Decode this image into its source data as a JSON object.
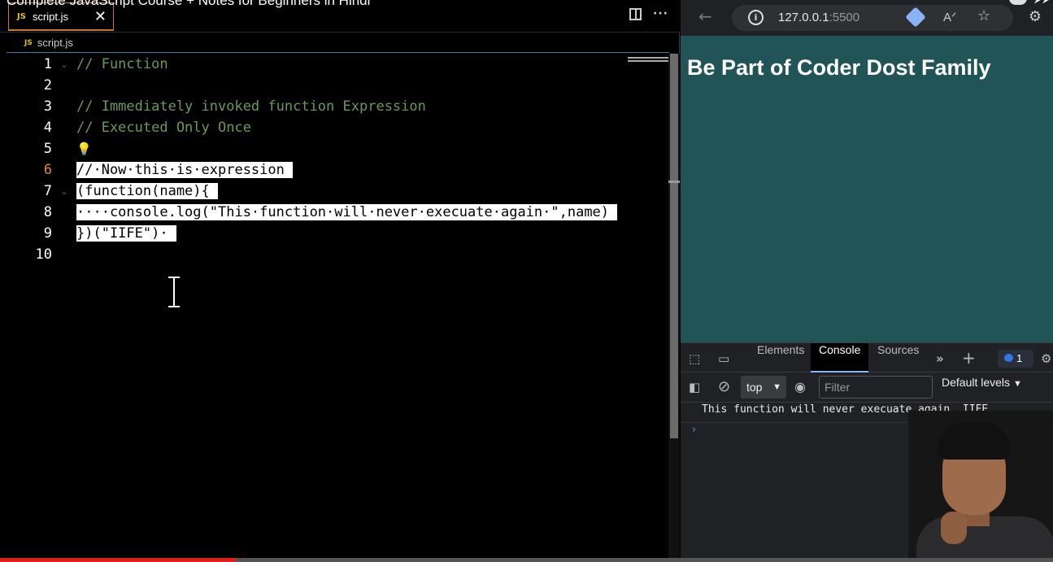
{
  "video": {
    "title": "Complete JavaScript Course + Notes for Beginners in Hindi",
    "progress_fraction": 0.224
  },
  "editor": {
    "tab_label": "script.js",
    "tab_badge": "JS",
    "tab_close": "✕",
    "breadcrumb_badge": "JS",
    "breadcrumb_file": "script.js",
    "lines": [
      {
        "n": "1",
        "text": "// Function",
        "fold": "⌄",
        "selected": false
      },
      {
        "n": "2",
        "text": "",
        "fold": "",
        "selected": false
      },
      {
        "n": "3",
        "text": "// Immediately invoked function Expression",
        "fold": "",
        "selected": false
      },
      {
        "n": "4",
        "text": "// Executed Only Once",
        "fold": "",
        "selected": false
      },
      {
        "n": "5",
        "text": "",
        "fold": "",
        "selected": false,
        "bulb": true
      },
      {
        "n": "6",
        "text": "//·Now·this·is·expression",
        "fold": "",
        "selected": true
      },
      {
        "n": "7",
        "text": "(function(name){",
        "fold": "⌄",
        "selected": true
      },
      {
        "n": "8",
        "text": "····console.log(\"This·function·will·never·execuate·again·\",name)",
        "fold": "",
        "selected": true
      },
      {
        "n": "9",
        "text": "})(\"IIFE\")·",
        "fold": "",
        "selected": true
      },
      {
        "n": "10",
        "text": "",
        "fold": "",
        "selected": false
      }
    ],
    "active_line": "6"
  },
  "browser": {
    "url_host": "127.0.0.1",
    "url_port": ":5500",
    "heading": "Be Part of Coder Dost Family",
    "page_bg": "#215456"
  },
  "devtools": {
    "tabs": [
      "Elements",
      "Console",
      "Sources"
    ],
    "active_tab": "Console",
    "issues_count": "1",
    "context": "top",
    "filter_placeholder": "Filter",
    "levels": "Default levels",
    "console_output": "This function will never execuate again  IIFE",
    "prompt": "›"
  }
}
